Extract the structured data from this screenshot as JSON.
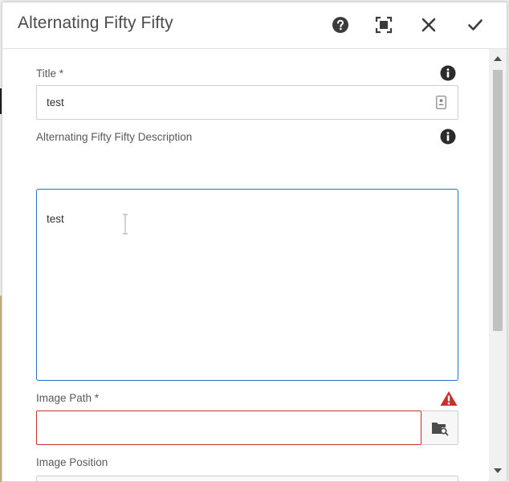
{
  "dialog": {
    "title": "Alternating Fifty Fifty",
    "actions": {
      "help": "help-icon",
      "fullscreen": "fullscreen-icon",
      "close": "close-icon",
      "done": "checkmark-icon"
    }
  },
  "fields": {
    "title": {
      "label": "Title *",
      "value": "test"
    },
    "description": {
      "label": "Alternating Fifty Fifty Description",
      "value": "test"
    },
    "image_path": {
      "label": "Image Path *",
      "value": "",
      "status": "invalid"
    },
    "image_position": {
      "label": "Image Position"
    }
  },
  "colors": {
    "focus_border": "#2c6dbf",
    "error": "#c9302c",
    "icon": "#3b3b3b"
  }
}
